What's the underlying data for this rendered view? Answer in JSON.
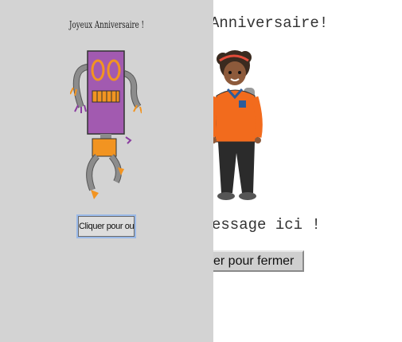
{
  "inside": {
    "title": "Anniversaire!",
    "message": "essage ici !",
    "close_button_label": "er pour fermer"
  },
  "cover": {
    "title": "Joyeux Anniversaire !",
    "open_button_label": "Cliquer pour ouvrir"
  },
  "colors": {
    "cover_background": "#d3d3d3",
    "robot_body": "#a25ab0",
    "robot_accent": "#f29421",
    "robot_limbs": "#8c8c8c",
    "girl_shirt": "#f26b1d"
  },
  "images": {
    "robot": "robot-illustration",
    "girl": "girl-illustration"
  }
}
